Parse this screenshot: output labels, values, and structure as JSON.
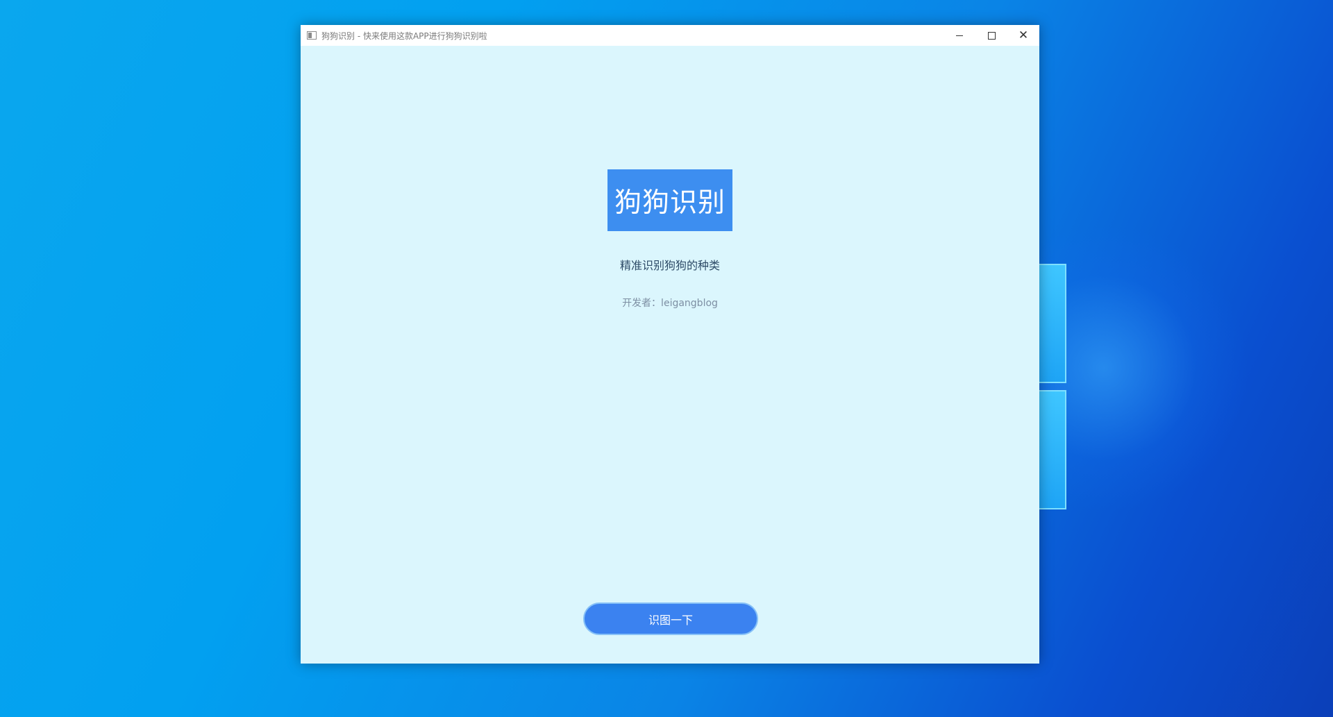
{
  "window": {
    "title": "狗狗识别 - 快来使用这款APP进行狗狗识别啦"
  },
  "controls": {
    "minimize": "minimize",
    "maximize": "maximize",
    "close": "✕"
  },
  "main": {
    "logo_text": "狗狗识别",
    "subtitle": "精准识别狗狗的种类",
    "developer": "开发者：leigangblog",
    "button_label": "识图一下"
  },
  "colors": {
    "accent": "#3d8ef0",
    "background": "#dbf6fd",
    "button": "#3b82f0"
  }
}
